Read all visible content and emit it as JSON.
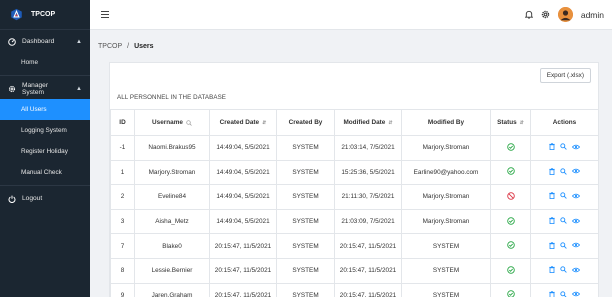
{
  "app": {
    "brand": "TPCOP",
    "username": "admin"
  },
  "sidebar": {
    "items": [
      {
        "type": "group",
        "label": "Dashboard",
        "icon": "dashboard-icon"
      },
      {
        "type": "sub",
        "label": "Home"
      },
      {
        "type": "group",
        "label": "Manager System",
        "icon": "gear-icon"
      },
      {
        "type": "sub",
        "label": "All Users",
        "active": true
      },
      {
        "type": "sub",
        "label": "Logging System"
      },
      {
        "type": "sub",
        "label": "Register Holiday"
      },
      {
        "type": "sub",
        "label": "Manual Check"
      },
      {
        "type": "group",
        "label": "Logout",
        "icon": "logout-icon"
      }
    ]
  },
  "breadcrumb": {
    "root": "TPCOP",
    "separator": "/",
    "current": "Users"
  },
  "toolbar": {
    "export_label": "Export (.xlsx)"
  },
  "table": {
    "title": "ALL PERSONNEL IN THE DATABASE",
    "headers": [
      "ID",
      "Username",
      "Created Date",
      "Created By",
      "Modified Date",
      "Modified By",
      "Status",
      "Actions"
    ],
    "rows": [
      {
        "id": "-1",
        "username": "Naomi.Brakus95",
        "created_date": "14:49:04, 5/5/2021",
        "created_by": "SYSTEM",
        "modified_date": "21:03:14, 7/5/2021",
        "modified_by": "Marjory.Stroman",
        "status": "active"
      },
      {
        "id": "1",
        "username": "Marjory.Stroman",
        "created_date": "14:49:04, 5/5/2021",
        "created_by": "SYSTEM",
        "modified_date": "15:25:36, 5/5/2021",
        "modified_by": "Earline90@yahoo.com",
        "status": "active"
      },
      {
        "id": "2",
        "username": "Eveline84",
        "created_date": "14:49:04, 5/5/2021",
        "created_by": "SYSTEM",
        "modified_date": "21:11:30, 7/5/2021",
        "modified_by": "Marjory.Stroman",
        "status": "disabled"
      },
      {
        "id": "3",
        "username": "Aisha_Metz",
        "created_date": "14:49:04, 5/5/2021",
        "created_by": "SYSTEM",
        "modified_date": "21:03:09, 7/5/2021",
        "modified_by": "Marjory.Stroman",
        "status": "active"
      },
      {
        "id": "7",
        "username": "Blake0",
        "created_date": "20:15:47, 11/5/2021",
        "created_by": "SYSTEM",
        "modified_date": "20:15:47, 11/5/2021",
        "modified_by": "SYSTEM",
        "status": "active"
      },
      {
        "id": "8",
        "username": "Lessie.Bernier",
        "created_date": "20:15:47, 11/5/2021",
        "created_by": "SYSTEM",
        "modified_date": "20:15:47, 11/5/2021",
        "modified_by": "SYSTEM",
        "status": "active"
      },
      {
        "id": "9",
        "username": "Jaren.Graham",
        "created_date": "20:15:47, 11/5/2021",
        "created_by": "SYSTEM",
        "modified_date": "20:15:47, 11/5/2021",
        "modified_by": "SYSTEM",
        "status": "active"
      }
    ]
  },
  "colors": {
    "sidebar_bg": "#1b2631",
    "accent": "#1e90ff",
    "status_ok": "#28a745",
    "status_bad": "#dc3545"
  }
}
